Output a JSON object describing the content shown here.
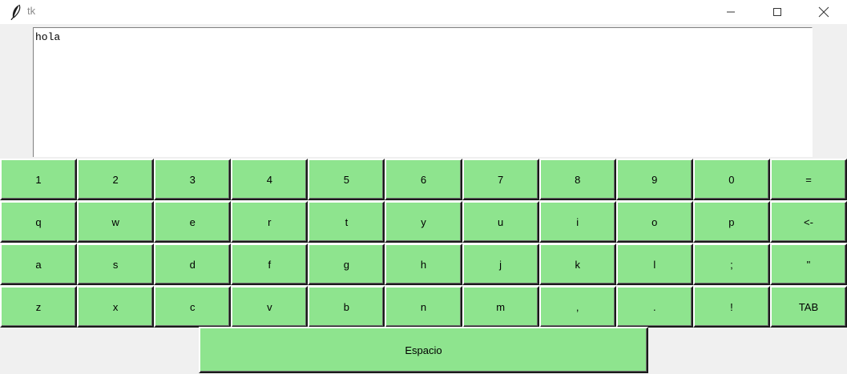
{
  "window": {
    "title": "tk",
    "icon": "feather-icon"
  },
  "text_area": {
    "value": "hola"
  },
  "keyboard": {
    "key_color": "#8ee48e",
    "rows": [
      [
        "1",
        "2",
        "3",
        "4",
        "5",
        "6",
        "7",
        "8",
        "9",
        "0",
        "="
      ],
      [
        "q",
        "w",
        "e",
        "r",
        "t",
        "y",
        "u",
        "i",
        "o",
        "p",
        "<-"
      ],
      [
        "a",
        "s",
        "d",
        "f",
        "g",
        "h",
        "j",
        "k",
        "l",
        ";",
        "\""
      ],
      [
        "z",
        "x",
        "c",
        "v",
        "b",
        "n",
        "m",
        ",",
        ".",
        "!",
        "TAB"
      ]
    ],
    "space_label": "Espacio"
  }
}
